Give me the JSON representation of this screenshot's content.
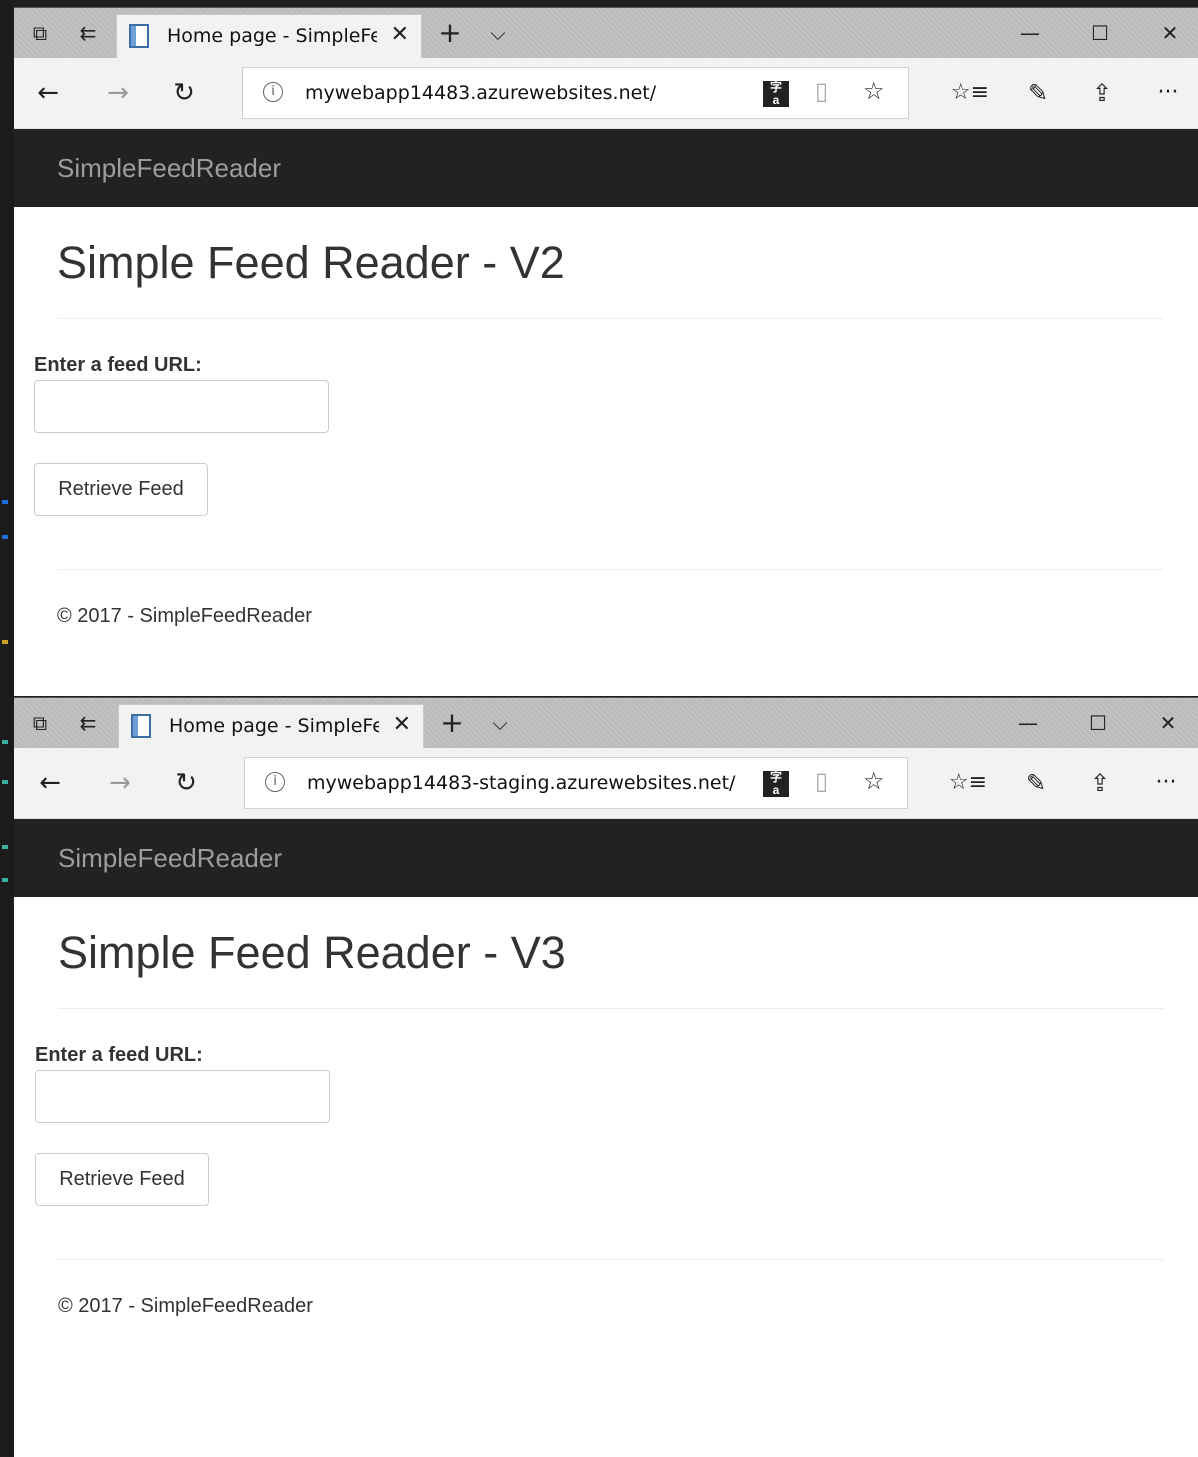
{
  "windows": [
    {
      "tab_title": "Home page - SimpleFee",
      "url": "mywebapp14483.azurewebsites.net/",
      "brand": "SimpleFeedReader",
      "heading": "Simple Feed Reader - V2",
      "feed_label": "Enter a feed URL:",
      "feed_input_value": "",
      "retrieve_button": "Retrieve Feed",
      "footer": "© 2017 - SimpleFeedReader"
    },
    {
      "tab_title": "Home page - SimpleFee",
      "url": "mywebapp14483-staging.azurewebsites.net/",
      "brand": "SimpleFeedReader",
      "heading": "Simple Feed Reader - V3",
      "feed_label": "Enter a feed URL:",
      "feed_input_value": "",
      "retrieve_button": "Retrieve Feed",
      "footer": "© 2017 - SimpleFeedReader"
    }
  ],
  "browser_chrome": {
    "tab_close_glyph": "✕",
    "new_tab_glyph": "+",
    "tab_list_glyph": "⌵",
    "minimize_glyph": "—",
    "maximize_glyph": "☐",
    "close_glyph": "✕",
    "back_glyph": "←",
    "forward_glyph": "→",
    "refresh_glyph": "↻",
    "info_glyph": "i",
    "reading_view_glyph": "▯",
    "favorite_glyph": "☆",
    "favorites_hub_glyph": "☆≡",
    "notes_glyph": "✎",
    "share_glyph": "⇪",
    "more_glyph": "···",
    "tab_preview_glyph": "⧉",
    "set_aside_glyph": "⇇"
  },
  "colors": {
    "navbar_bg": "#222222",
    "brand_text": "#9d9d9d",
    "tabbar_bg": "#bdbdbd",
    "addressbar_bg": "#f2f2f2"
  }
}
